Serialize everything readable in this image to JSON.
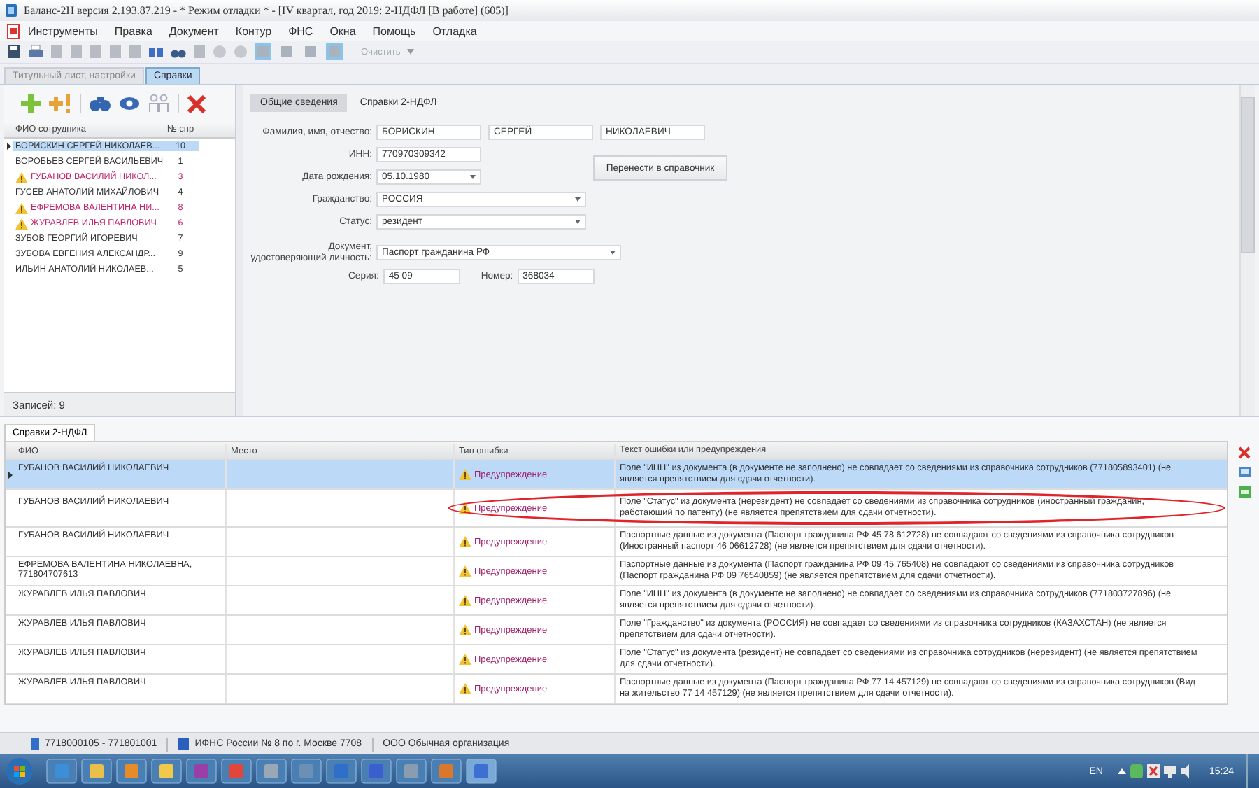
{
  "window": {
    "title": "Баланс-2Н версия 2.193.87.219  - * Режим отладки * - [IV квартал, год 2019: 2-НДФЛ [В работе] (605)]"
  },
  "menu": [
    "Инструменты",
    "Правка",
    "Документ",
    "Контур",
    "ФНС",
    "Окна",
    "Помощь",
    "Отладка"
  ],
  "toolbar": {
    "clear_label": "Очистить"
  },
  "tabs": [
    {
      "label": "Титульный лист, настройки",
      "selected": false
    },
    {
      "label": "Справки",
      "selected": true
    }
  ],
  "employees": {
    "columns": [
      "ФИО сотрудника",
      "№ спр"
    ],
    "rows": [
      {
        "name": "БОРИСКИН СЕРГЕЙ НИКОЛАЕВ...",
        "num": "10",
        "warning": false,
        "selected": true
      },
      {
        "name": "ВОРОБЬЕВ СЕРГЕЙ ВАСИЛЬЕВИЧ",
        "num": "1",
        "warning": false,
        "selected": false
      },
      {
        "name": "ГУБАНОВ ВАСИЛИЙ НИКОЛ...",
        "num": "3",
        "warning": true,
        "selected": false
      },
      {
        "name": "ГУСЕВ АНАТОЛИЙ МИХАЙЛОВИЧ",
        "num": "4",
        "warning": false,
        "selected": false
      },
      {
        "name": "ЕФРЕМОВА ВАЛЕНТИНА НИ...",
        "num": "8",
        "warning": true,
        "selected": false
      },
      {
        "name": "ЖУРАВЛЕВ ИЛЬЯ ПАВЛОВИЧ",
        "num": "6",
        "warning": true,
        "selected": false
      },
      {
        "name": "ЗУБОВ ГЕОРГИЙ ИГОРЕВИЧ",
        "num": "7",
        "warning": false,
        "selected": false
      },
      {
        "name": "ЗУБОВА ЕВГЕНИЯ АЛЕКСАНДР...",
        "num": "9",
        "warning": false,
        "selected": false
      },
      {
        "name": "ИЛЬИН АНАТОЛИЙ НИКОЛАЕВ...",
        "num": "5",
        "warning": false,
        "selected": false
      }
    ],
    "records": "Записей: 9"
  },
  "form": {
    "tabs": [
      {
        "label": "Общие сведения",
        "selected": true
      },
      {
        "label": "Справки 2-НДФЛ",
        "selected": false
      }
    ],
    "fio_label": "Фамилия, имя, отчество:",
    "last_name": "БОРИСКИН",
    "first_name": "СЕРГЕЙ",
    "middle_name": "НИКОЛАЕВИЧ",
    "inn_label": "ИНН:",
    "inn": "770970309342",
    "birth_label": "Дата рождения:",
    "birth": "05.10.1980",
    "citizenship_label": "Гражданство:",
    "citizenship": "РОССИЯ",
    "status_label": "Статус:",
    "status": "резидент",
    "doc_label": "Документ, удостоверяющий личность:",
    "doc": "Паспорт гражданина РФ",
    "series_label": "Серия:",
    "series": "45 09",
    "number_label": "Номер:",
    "number": "368034",
    "transfer_button": "Перенести в справочник"
  },
  "errors": {
    "tab": "Справки 2-НДФЛ",
    "columns": [
      "ФИО",
      "Место",
      "Тип ошибки",
      "Текст ошибки или предупреждения"
    ],
    "rows": [
      {
        "fio": "ГУБАНОВ ВАСИЛИЙ НИКОЛАЕВИЧ",
        "type": "Предупреждение",
        "text": "Поле \"ИНН\" из документа (в документе не заполнено) не совпадает со сведениями из справочника сотрудников (771805893401) (не является препятствием для сдачи отчетности).",
        "selected": true,
        "circled": false
      },
      {
        "fio": "ГУБАНОВ ВАСИЛИЙ НИКОЛАЕВИЧ",
        "type": "Предупреждение",
        "text": "Поле \"Статус\" из документа (нерезидент) не совпадает со сведениями из справочника сотрудников (иностранный гражданин, работающий по патенту) (не является препятствием для сдачи отчетности).",
        "selected": false,
        "circled": true
      },
      {
        "fio": "ГУБАНОВ ВАСИЛИЙ НИКОЛАЕВИЧ",
        "type": "Предупреждение",
        "text": "Паспортные данные из документа (Паспорт гражданина РФ 45 78 612728) не совпадают со сведениями из справочника сотрудников (Иностранный паспорт 46 06612728) (не является препятствием для сдачи отчетности).",
        "selected": false,
        "circled": false
      },
      {
        "fio": "ЕФРЕМОВА ВАЛЕНТИНА НИКОЛАЕВНА, 771804707613",
        "type": "Предупреждение",
        "text": "Паспортные данные из документа (Паспорт гражданина РФ 09 45 765408) не совпадают со сведениями из справочника сотрудников (Паспорт гражданина РФ 09 76540859) (не является препятствием для сдачи отчетности).",
        "selected": false,
        "circled": false
      },
      {
        "fio": "ЖУРАВЛЕВ ИЛЬЯ ПАВЛОВИЧ",
        "type": "Предупреждение",
        "text": "Поле \"ИНН\" из документа (в документе не заполнено) не совпадает со сведениями из справочника сотрудников (771803727896) (не является препятствием для сдачи отчетности).",
        "selected": false,
        "circled": false
      },
      {
        "fio": "ЖУРАВЛЕВ ИЛЬЯ ПАВЛОВИЧ",
        "type": "Предупреждение",
        "text": "Поле \"Гражданство\" из документа (РОССИЯ) не совпадает со сведениями из справочника сотрудников (КАЗАХСТАН) (не является препятствием для сдачи отчетности).",
        "selected": false,
        "circled": false
      },
      {
        "fio": "ЖУРАВЛЕВ ИЛЬЯ ПАВЛОВИЧ",
        "type": "Предупреждение",
        "text": "Поле \"Статус\" из документа (резидент) не совпадает со сведениями из справочника сотрудников (нерезидент) (не является препятствием для сдачи отчетности).",
        "selected": false,
        "circled": false
      },
      {
        "fio": "ЖУРАВЛЕВ ИЛЬЯ ПАВЛОВИЧ",
        "type": "Предупреждение",
        "text": "Паспортные данные из документа (Паспорт гражданина РФ 77 14 457129) не совпадают со сведениями из справочника сотрудников (Вид на жительство 77 14 457129) (не является препятствием для сдачи отчетности).",
        "selected": false,
        "circled": false
      }
    ]
  },
  "status_bar": [
    "7718000105 - 771801001",
    "ИФНС России № 8 по г. Москве 7708",
    "ООО Обычная организация"
  ],
  "taskbar": {
    "language": "EN",
    "time": "15:24"
  }
}
